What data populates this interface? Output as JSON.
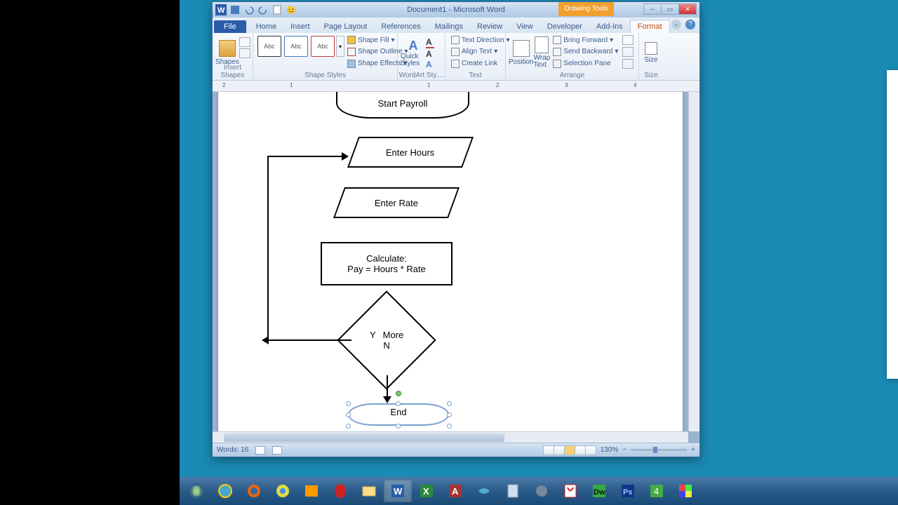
{
  "window": {
    "title": "Document1 - Microsoft Word",
    "context_tab": "Drawing Tools"
  },
  "tabs": {
    "file": "File",
    "list": [
      "Home",
      "Insert",
      "Page Layout",
      "References",
      "Mailings",
      "Review",
      "View",
      "Developer",
      "Add-Ins",
      "Format"
    ],
    "active_index": 9
  },
  "ribbon": {
    "insert_shapes": {
      "label": "Insert Shapes",
      "shapes": "Shapes"
    },
    "shape_styles": {
      "label": "Shape Styles",
      "abc": "Abc",
      "fill": "Shape Fill",
      "outline": "Shape Outline",
      "effects": "Shape Effects"
    },
    "wordart": {
      "label": "WordArt Sty…",
      "quick": "Quick Styles"
    },
    "text": {
      "label": "Text",
      "direction": "Text Direction",
      "align": "Align Text",
      "link": "Create Link"
    },
    "arrange": {
      "label": "Arrange",
      "position": "Position",
      "wrap": "Wrap Text",
      "forward": "Bring Forward",
      "backward": "Send Backward",
      "selection": "Selection Pane"
    },
    "size": {
      "label": "Size",
      "size": "Size"
    }
  },
  "flowchart": {
    "start": "Start Payroll",
    "hours": "Enter Hours",
    "rate": "Enter Rate",
    "calc1": "Calculate:",
    "calc2": "Pay = Hours * Rate",
    "dec_y": "Y",
    "dec_more": "More",
    "dec_n": "N",
    "end": "End"
  },
  "ruler_marks": [
    "2",
    "1",
    "1",
    "2",
    "3",
    "4"
  ],
  "status": {
    "words": "Words: 16",
    "zoom": "130%"
  }
}
